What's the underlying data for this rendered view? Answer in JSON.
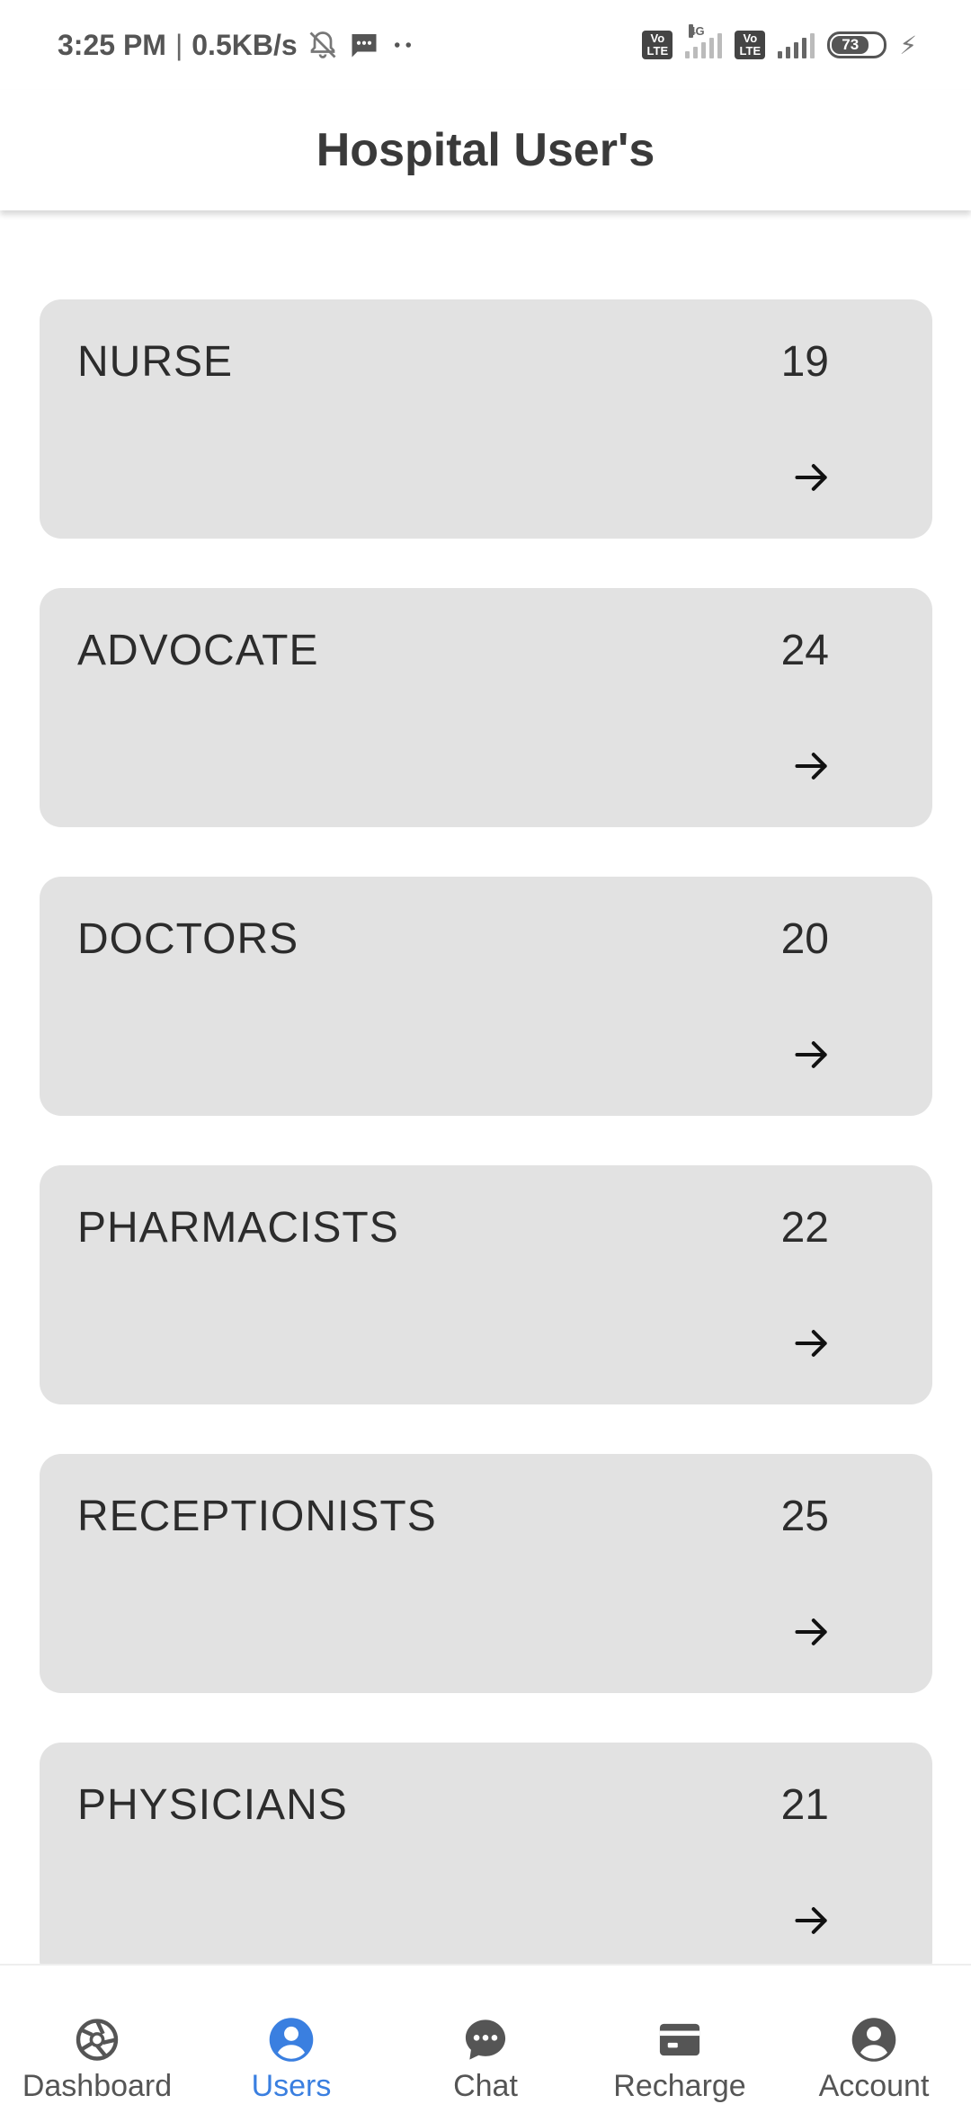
{
  "status_bar": {
    "time": "3:25 PM",
    "separator": "|",
    "speed": "0.5KB/s",
    "network1": "4G",
    "volte": "Vo LTE",
    "battery": "73"
  },
  "header": {
    "title": "Hospital User's"
  },
  "cards": [
    {
      "title": "NURSE",
      "count": "19"
    },
    {
      "title": "ADVOCATE",
      "count": "24"
    },
    {
      "title": "DOCTORS",
      "count": "20"
    },
    {
      "title": "PHARMACISTS",
      "count": "22"
    },
    {
      "title": "RECEPTIONISTS",
      "count": "25"
    },
    {
      "title": "PHYSICIANS",
      "count": "21"
    }
  ],
  "nav": {
    "items": [
      {
        "label": "Dashboard",
        "icon": "aperture-icon"
      },
      {
        "label": "Users",
        "icon": "account-circle-icon"
      },
      {
        "label": "Chat",
        "icon": "chat-bubble-icon"
      },
      {
        "label": "Recharge",
        "icon": "card-icon"
      },
      {
        "label": "Account",
        "icon": "account-circle-icon"
      }
    ],
    "active": "Users",
    "active_color": "#3a7fe0",
    "inactive_color": "#555555"
  },
  "colors": {
    "card_bg": "#e2e2e2",
    "page_bg": "#ffffff",
    "title_text": "#3a3a3a"
  }
}
